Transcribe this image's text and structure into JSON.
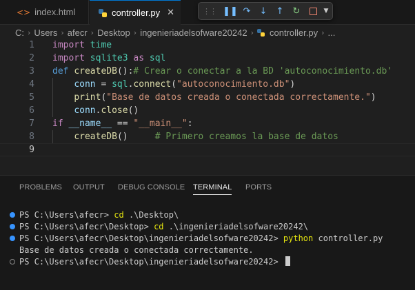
{
  "tabs": [
    {
      "label": "index.html",
      "icon": "html-file-icon"
    },
    {
      "label": "controller.py",
      "icon": "python-file-icon",
      "close": "✕"
    }
  ],
  "debug_toolbar": {
    "icons": [
      "drag-grip-icon",
      "pause-icon",
      "step-over-icon",
      "step-into-icon",
      "step-out-icon",
      "restart-icon",
      "stop-icon",
      "chevron-down-icon"
    ]
  },
  "breadcrumb": [
    "C:",
    "Users",
    "afecr",
    "Desktop",
    "ingenieriadelsofware20242",
    "controller.py",
    "..."
  ],
  "editor": {
    "line_numbers": [
      "1",
      "2",
      "3",
      "4",
      "5",
      "6",
      "7",
      "8",
      "9"
    ],
    "lines": [
      [
        [
          "import",
          "kw"
        ],
        [
          " ",
          "pl"
        ],
        [
          "time",
          "mod"
        ]
      ],
      [
        [
          "import",
          "kw"
        ],
        [
          " ",
          "pl"
        ],
        [
          "sqlite3",
          "mod"
        ],
        [
          " ",
          "pl"
        ],
        [
          "as",
          "kw"
        ],
        [
          " ",
          "pl"
        ],
        [
          "sql",
          "mod"
        ]
      ],
      [
        [
          "def",
          "def"
        ],
        [
          " ",
          "pl"
        ],
        [
          "createDB",
          "fn"
        ],
        [
          "():",
          "pl"
        ],
        [
          "# Crear o conectar a la BD 'autoconocimiento.db'",
          "cm"
        ]
      ],
      [
        [
          "    ",
          "pl"
        ],
        [
          "conn",
          "var"
        ],
        [
          " = ",
          "pl"
        ],
        [
          "sql",
          "mod"
        ],
        [
          ".",
          "pl"
        ],
        [
          "connect",
          "fn"
        ],
        [
          "(",
          "pl"
        ],
        [
          "\"autoconocimiento.db\"",
          "str"
        ],
        [
          ")",
          "pl"
        ]
      ],
      [
        [
          "    ",
          "pl"
        ],
        [
          "print",
          "fn"
        ],
        [
          "(",
          "pl"
        ],
        [
          "\"Base de datos creada o conectada correctamente.\"",
          "str"
        ],
        [
          ")",
          "pl"
        ]
      ],
      [
        [
          "    ",
          "pl"
        ],
        [
          "conn",
          "var"
        ],
        [
          ".",
          "pl"
        ],
        [
          "close",
          "fn"
        ],
        [
          "()",
          "pl"
        ]
      ],
      [
        [
          "if",
          "kw"
        ],
        [
          " ",
          "pl"
        ],
        [
          "__name__",
          "var"
        ],
        [
          " == ",
          "pl"
        ],
        [
          "\"__main__\"",
          "str"
        ],
        [
          ":",
          "pl"
        ]
      ],
      [
        [
          "    ",
          "pl"
        ],
        [
          "createDB",
          "fn"
        ],
        [
          "()",
          "pl"
        ],
        [
          "     ",
          "pl"
        ],
        [
          "# Primero creamos la base de datos",
          "cm"
        ]
      ],
      []
    ]
  },
  "panel": {
    "tabs": [
      "PROBLEMS",
      "OUTPUT",
      "DEBUG CONSOLE",
      "TERMINAL",
      "PORTS"
    ],
    "active_tab": "TERMINAL"
  },
  "terminal": {
    "lines": [
      {
        "marker": "filled",
        "prompt": "PS C:\\Users\\afecr> ",
        "cmd": "cd",
        "rest": " .\\Desktop\\"
      },
      {
        "marker": "filled",
        "prompt": "PS C:\\Users\\afecr\\Desktop> ",
        "cmd": "cd",
        "rest": " .\\ingenieriadelsofware20242\\"
      },
      {
        "marker": "filled",
        "prompt": "PS C:\\Users\\afecr\\Desktop\\ingenieriadelsofware20242> ",
        "cmd": "python",
        "rest": " controller.py"
      },
      {
        "marker": "none",
        "prompt": "Base de datos creada o conectada correctamente.",
        "cmd": "",
        "rest": ""
      },
      {
        "marker": "hollow",
        "prompt": "PS C:\\Users\\afecr\\Desktop\\ingenieriadelsofware20242> ",
        "cmd": "",
        "rest": "",
        "cursor": true
      }
    ]
  },
  "colors": {
    "editor_bg": "#1f1f1f",
    "panel_bg": "#181818",
    "accent": "#0078d4",
    "keyword": "#c586c0",
    "string": "#ce9178",
    "comment": "#6a9955",
    "function": "#dcdcaa"
  }
}
